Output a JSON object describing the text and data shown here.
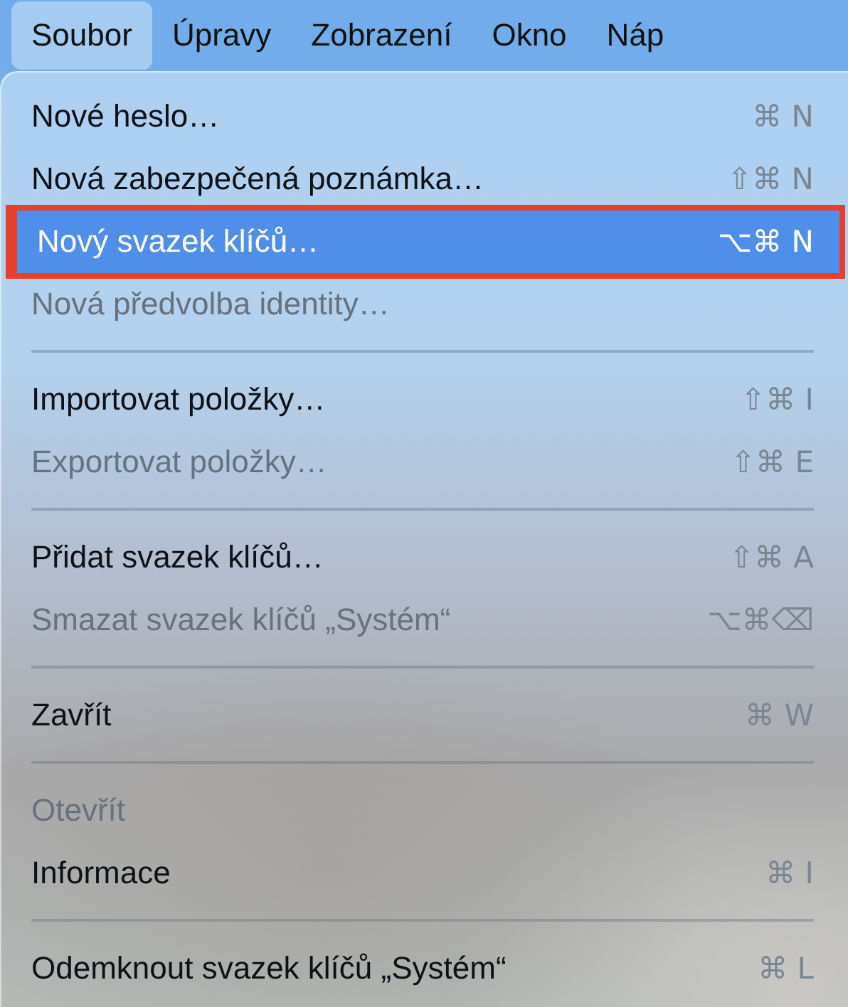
{
  "menubar": [
    {
      "label": "Soubor",
      "selected": true
    },
    {
      "label": "Úpravy",
      "selected": false
    },
    {
      "label": "Zobrazení",
      "selected": false
    },
    {
      "label": "Okno",
      "selected": false
    },
    {
      "label": "Náp",
      "selected": false
    }
  ],
  "menu": {
    "items": [
      {
        "kind": "item",
        "label": "Nové heslo…",
        "shortcut": "⌘ N",
        "disabled": false,
        "selected": false,
        "outlined": false
      },
      {
        "kind": "item",
        "label": "Nová zabezpečená poznámka…",
        "shortcut": "⇧⌘ N",
        "disabled": false,
        "selected": false,
        "outlined": false
      },
      {
        "kind": "item",
        "label": "Nový svazek klíčů…",
        "shortcut": "⌥⌘ N",
        "disabled": false,
        "selected": true,
        "outlined": true
      },
      {
        "kind": "item",
        "label": "Nová předvolba identity…",
        "disabled": true,
        "selected": false,
        "outlined": false
      },
      {
        "kind": "separator"
      },
      {
        "kind": "item",
        "label": "Importovat položky…",
        "shortcut": "⇧⌘ I",
        "disabled": false,
        "selected": false,
        "outlined": false
      },
      {
        "kind": "item",
        "label": "Exportovat položky…",
        "shortcut": "⇧⌘ E",
        "disabled": true,
        "selected": false,
        "outlined": false
      },
      {
        "kind": "separator"
      },
      {
        "kind": "item",
        "label": "Přidat svazek klíčů…",
        "shortcut": "⇧⌘ A",
        "disabled": false,
        "selected": false,
        "outlined": false
      },
      {
        "kind": "item",
        "label": "Smazat svazek klíčů „Systém“",
        "shortcut": "⌥⌘⌫",
        "disabled": true,
        "selected": false,
        "outlined": false
      },
      {
        "kind": "separator"
      },
      {
        "kind": "item",
        "label": "Zavřít",
        "shortcut": "⌘ W",
        "disabled": false,
        "selected": false,
        "outlined": false
      },
      {
        "kind": "separator"
      },
      {
        "kind": "item",
        "label": "Otevřít",
        "disabled": true,
        "selected": false,
        "outlined": false
      },
      {
        "kind": "item",
        "label": "Informace",
        "shortcut": "⌘ I",
        "disabled": false,
        "selected": false,
        "outlined": false
      },
      {
        "kind": "separator"
      },
      {
        "kind": "item",
        "label": "Odemknout svazek klíčů „Systém“",
        "shortcut": "⌘ L",
        "disabled": false,
        "selected": false,
        "outlined": false
      }
    ]
  }
}
